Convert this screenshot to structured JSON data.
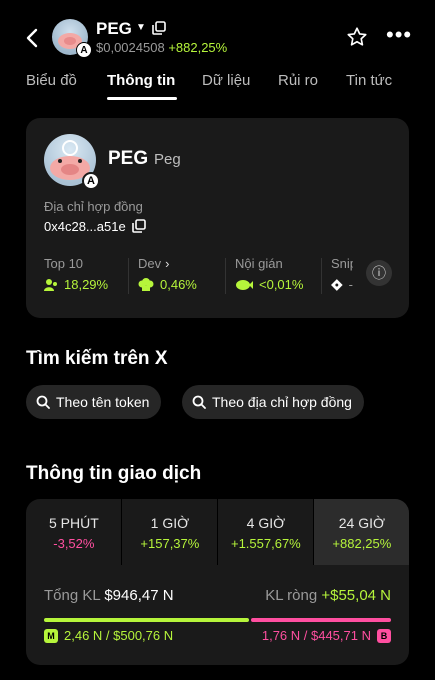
{
  "header": {
    "symbol": "PEG",
    "price": "$0,0024508",
    "change": "+882,25%"
  },
  "tabs": [
    "Biểu đồ",
    "Thông tin",
    "Dữ liệu",
    "Rủi ro",
    "Tin tức"
  ],
  "token": {
    "symbol": "PEG",
    "name": "Peg",
    "contract_label": "Địa chỉ hợp đồng",
    "contract_addr": "0x4c28...a51e"
  },
  "stats": [
    {
      "label": "Top 10",
      "value": "18,29%"
    },
    {
      "label": "Dev",
      "value": "0,46%"
    },
    {
      "label": "Nội gián",
      "value": "<0,01%"
    },
    {
      "label": "Snip",
      "value": "-"
    }
  ],
  "search_x": {
    "title": "Tìm kiếm trên X",
    "by_name": "Theo tên token",
    "by_addr": "Theo địa chỉ hợp đồng"
  },
  "trade": {
    "title": "Thông tin giao dịch",
    "periods": [
      {
        "label": "5 PHÚT",
        "value": "-3,52%"
      },
      {
        "label": "1 GIỜ",
        "value": "+157,37%"
      },
      {
        "label": "4 GIỜ",
        "value": "+1.557,67%"
      },
      {
        "label": "24 GIỜ",
        "value": "+882,25%"
      }
    ],
    "total_label": "Tổng KL",
    "total_value": "$946,47 N",
    "net_label": "KL ròng",
    "net_value": "+$55,04 N",
    "buy_badge": "M",
    "buy_text": "2,46 N / $500,76 N",
    "sell_text": "1,76 N / $445,71 N",
    "sell_badge": "B",
    "buy_share": 0.59
  },
  "colors": {
    "accent_green": "#b6f53b",
    "accent_pink": "#ff4fa0"
  }
}
